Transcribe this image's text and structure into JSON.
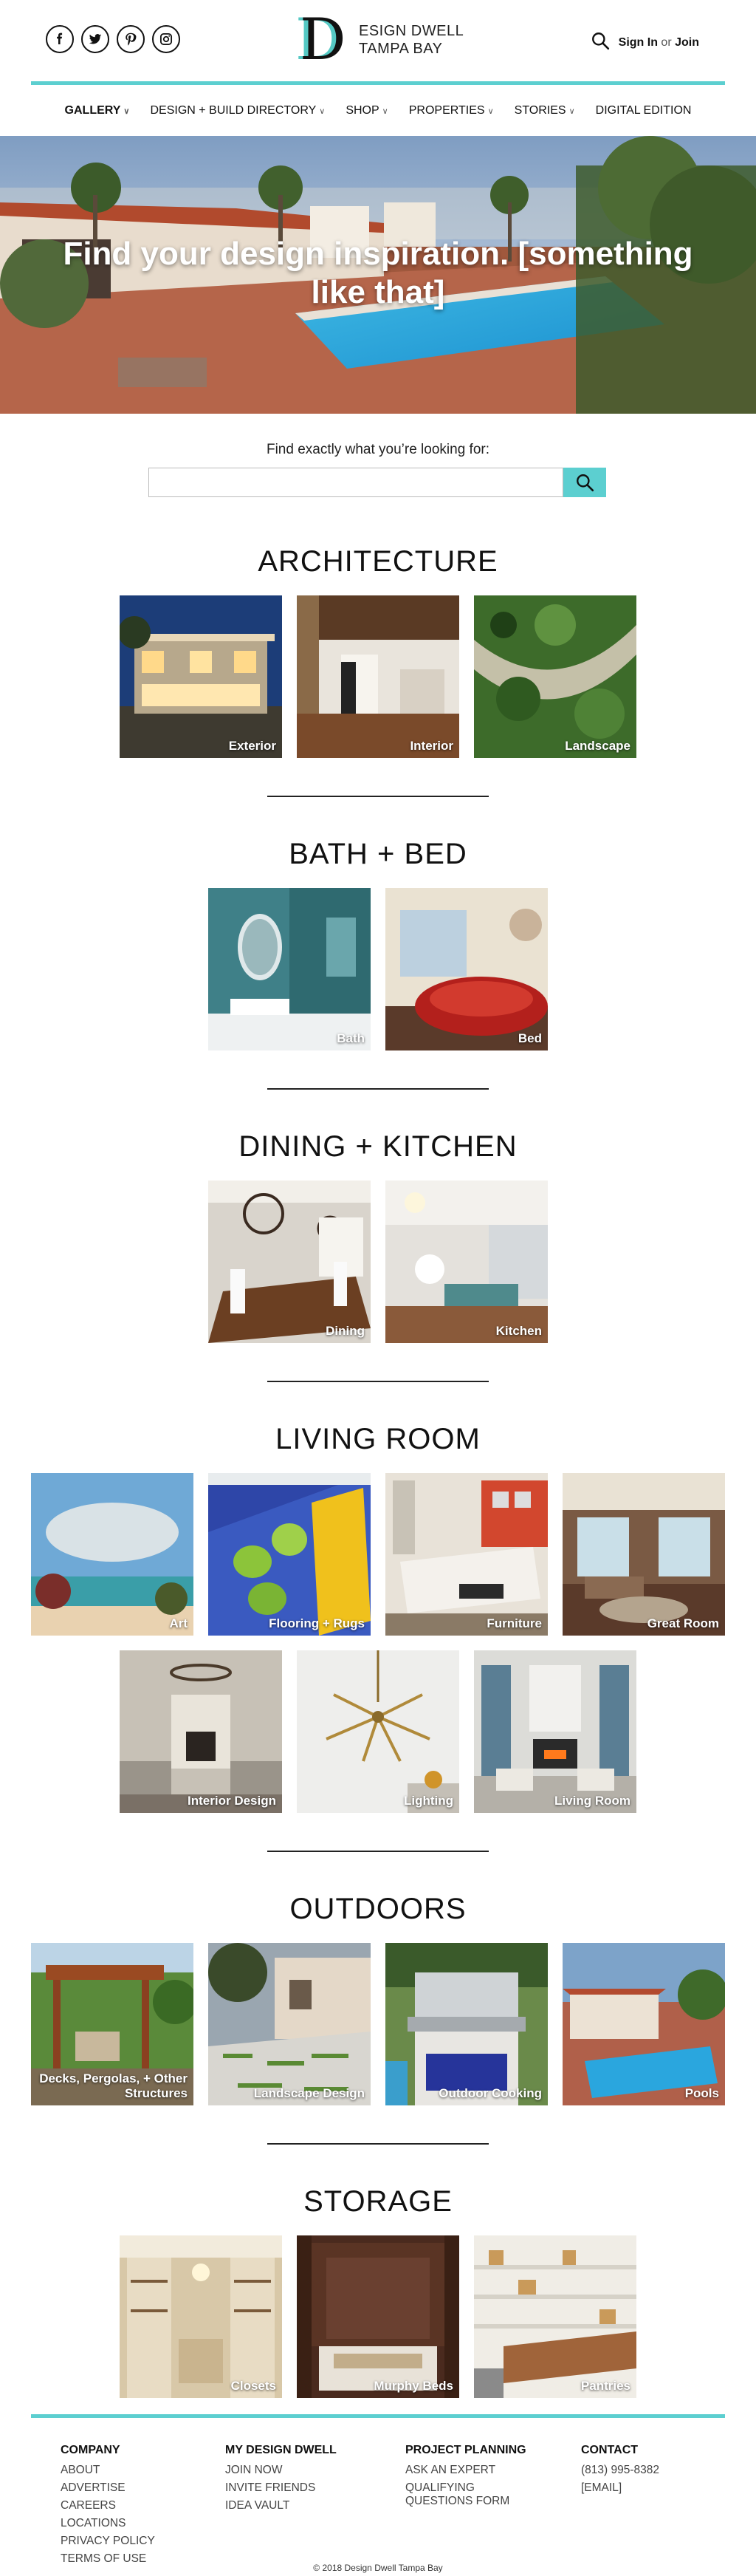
{
  "social": [
    "facebook-icon",
    "twitter-icon",
    "pinterest-icon",
    "instagram-icon"
  ],
  "logo": {
    "letter": "D",
    "line1": "ESIGN DWELL",
    "line2": "TAMPA BAY"
  },
  "auth": {
    "sign_in": "Sign In",
    "or": "or",
    "join": "Join"
  },
  "nav": [
    {
      "label": "GALLERY",
      "caret": "∨"
    },
    {
      "label": "DESIGN + BUILD DIRECTORY",
      "caret": "∨"
    },
    {
      "label": "SHOP",
      "caret": "∨"
    },
    {
      "label": "PROPERTIES",
      "caret": "∨"
    },
    {
      "label": "STORIES",
      "caret": "∨"
    },
    {
      "label": "DIGITAL EDITION",
      "caret": ""
    }
  ],
  "hero": {
    "headline": "Find your design inspiration. [something like that]"
  },
  "search": {
    "label": "Find exactly what you’re looking for:",
    "placeholder": ""
  },
  "sections": [
    {
      "title": "ARCHITECTURE",
      "tiles": [
        "Exterior",
        "Interior",
        "Landscape"
      ]
    },
    {
      "title": "BATH + BED",
      "tiles": [
        "Bath",
        "Bed"
      ]
    },
    {
      "title": "DINING + KITCHEN",
      "tiles": [
        "Dining",
        "Kitchen"
      ]
    },
    {
      "title": "LIVING ROOM",
      "tiles": [
        "Art",
        "Flooring + Rugs",
        "Furniture",
        "Great Room",
        "Interior Design",
        "Lighting",
        "Living Room"
      ]
    },
    {
      "title": "OUTDOORS",
      "tiles": [
        "Decks, Pergolas, + Other Structures",
        "Landscape Design",
        "Outdoor Cooking",
        "Pools"
      ]
    },
    {
      "title": "STORAGE",
      "tiles": [
        "Closets",
        "Murphy Beds",
        "Pantries"
      ]
    }
  ],
  "footer": {
    "columns": [
      {
        "heading": "COMPANY",
        "links": [
          "ABOUT",
          "ADVERTISE",
          "CAREERS",
          "LOCATIONS",
          "PRIVACY POLICY",
          "TERMS OF USE"
        ]
      },
      {
        "heading": "MY DESIGN DWELL",
        "links": [
          "JOIN NOW",
          "INVITE FRIENDS",
          "IDEA VAULT"
        ]
      },
      {
        "heading": "PROJECT PLANNING",
        "links": [
          "ASK AN EXPERT",
          "QUALIFYING",
          "QUESTIONS FORM"
        ]
      },
      {
        "heading": "CONTACT",
        "links": [
          "(813) 995-8382",
          "[EMAIL]"
        ]
      }
    ],
    "copyright": "© 2018 Design Dwell Tampa Bay"
  },
  "colors": {
    "accent": "#5ccfd0",
    "text": "#111111"
  }
}
